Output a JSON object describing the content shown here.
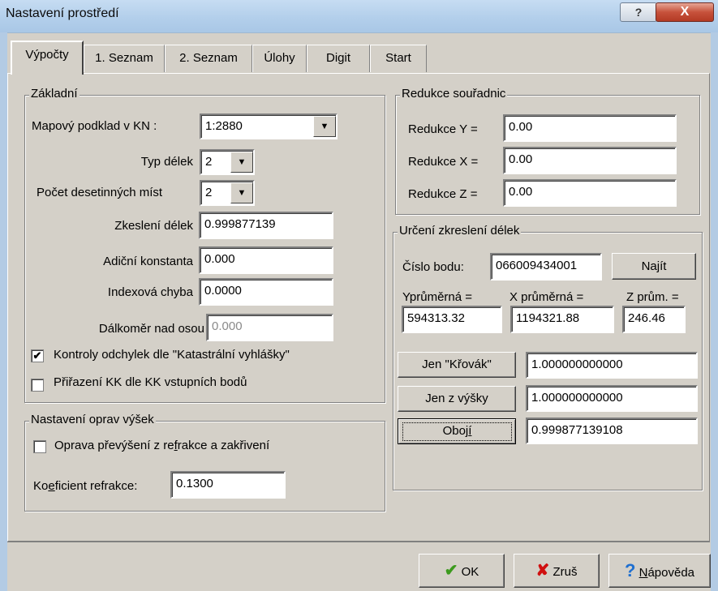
{
  "window": {
    "title": "Nastavení prostředí",
    "help_glyph": "?",
    "close_glyph": "X"
  },
  "tabs": [
    "Výpočty",
    "1. Seznam",
    "2. Seznam",
    "Úlohy",
    "Digit",
    "Start"
  ],
  "zakladni": {
    "title": "Základní",
    "mapovy_label": "Mapový podklad v KN :",
    "mapovy_value": "1:2880",
    "typ_label": "Typ délek",
    "typ_value": "2",
    "pocet_label": "Počet desetinných míst",
    "pocet_value": "2",
    "zkesleni_label": "Zkeslení délek",
    "zkesleni_value": "0.999877139",
    "adicni_label": "Adiční konstanta",
    "adicni_value": "0.000",
    "index_label": "Indexová chyba",
    "index_value": "0.0000",
    "dalkomer_label": "Dálkoměr nad osou",
    "dalkomer_value": "0.000",
    "kontroly_label": "Kontroly odchylek dle \"Katastrální vyhlášky\"",
    "kontroly_checked": true,
    "prirazeni_label": "Přiřazení KK dle KK vstupních bodů",
    "prirazeni_checked": false,
    "check_glyph": "✔"
  },
  "opravy": {
    "title": "Nastavení oprav výšek",
    "oprava_pre": "Oprava převýšení z re",
    "oprava_u": "f",
    "oprava_post": "rakce a zakřivení",
    "oprava_checked": false,
    "koef_pre": "Ko",
    "koef_u": "e",
    "koef_post": "ficient refrakce:",
    "koef_value": "0.1300"
  },
  "redukce": {
    "title": "Redukce souřadnic",
    "y_label": "Redukce Y =",
    "y_value": "0.00",
    "x_label": "Redukce X =",
    "x_value": "0.00",
    "z_label": "Redukce Z =",
    "z_value": "0.00"
  },
  "urceni": {
    "title": "Určení zkreslení délek",
    "cislo_label": "Číslo bodu:",
    "cislo_value": "066009434001",
    "najit_label": "Najít",
    "y_prum_label": "Yprůměrná =",
    "y_prum_value": "594313.32",
    "x_prum_label": "X průměrná =",
    "x_prum_value": "1194321.88",
    "z_prum_label": "Z prům. =",
    "z_prum_value": "246.46",
    "krovak_label": "Jen \"Křovák\"",
    "krovak_value": "1.000000000000",
    "vysky_label": "Jen z výšky",
    "vysky_value": "1.000000000000",
    "oboji_label": "Oboj",
    "oboji_u": "í",
    "oboji_value": "0.999877139108"
  },
  "footer": {
    "ok_icon": "✔",
    "ok_label": "OK",
    "zrus_icon": "✘",
    "zrus_label": "Zruš",
    "napoveda_icon": "?",
    "napoveda_u": "N",
    "napoveda_rest": "ápověda"
  },
  "colors": {
    "ok_green": "#3c9a1e",
    "cancel_red": "#d01010",
    "help_blue": "#1f6fd0",
    "title_bar": "#b9d1ea"
  }
}
